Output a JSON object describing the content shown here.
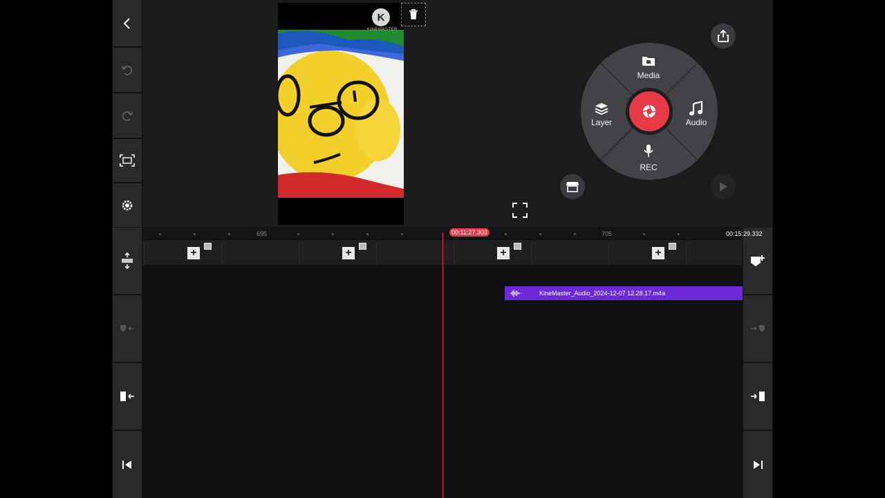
{
  "preview": {
    "logo_letter": "K",
    "logo_text": "KINEMASTER"
  },
  "wheel": {
    "media_label": "Media",
    "layer_label": "Layer",
    "audio_label": "Audio",
    "rec_label": "REC"
  },
  "timeline": {
    "ruler_label_1": "695",
    "ruler_label_2": "705",
    "current_time": "00:11:27.303",
    "end_time": "00:15:29.332",
    "audio_clip_name": "KineMaster_Audio_2024-12-07 12.28.17.m4a"
  },
  "colors": {
    "accent_red": "#e63a47",
    "audio_clip": "#6d28d9"
  }
}
